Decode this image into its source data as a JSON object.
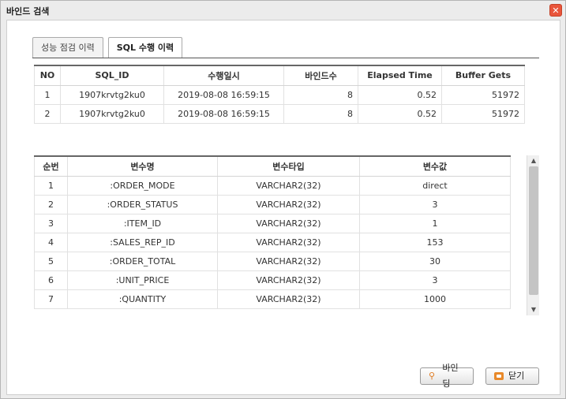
{
  "window": {
    "title": "바인드 검색",
    "close_glyph": "✕"
  },
  "tabs": [
    {
      "label": "성능 점검 이력",
      "active": false
    },
    {
      "label": "SQL 수행 이력",
      "active": true
    }
  ],
  "sql_table": {
    "headers": [
      "NO",
      "SQL_ID",
      "수행일시",
      "바인드수",
      "Elapsed Time",
      "Buffer Gets"
    ],
    "rows": [
      [
        "1",
        "1907krvtg2ku0",
        "2019-08-08 16:59:15",
        "8",
        "0.52",
        "51972"
      ],
      [
        "2",
        "1907krvtg2ku0",
        "2019-08-08 16:59:15",
        "8",
        "0.52",
        "51972"
      ]
    ]
  },
  "bind_table": {
    "headers": [
      "순번",
      "변수명",
      "변수타입",
      "변수값"
    ],
    "rows": [
      [
        "1",
        ":ORDER_MODE",
        "VARCHAR2(32)",
        "direct"
      ],
      [
        "2",
        ":ORDER_STATUS",
        "VARCHAR2(32)",
        "3"
      ],
      [
        "3",
        ":ITEM_ID",
        "VARCHAR2(32)",
        "1"
      ],
      [
        "4",
        ":SALES_REP_ID",
        "VARCHAR2(32)",
        "153"
      ],
      [
        "5",
        ":ORDER_TOTAL",
        "VARCHAR2(32)",
        "30"
      ],
      [
        "6",
        ":UNIT_PRICE",
        "VARCHAR2(32)",
        "3"
      ],
      [
        "7",
        ":QUANTITY",
        "VARCHAR2(32)",
        "1000"
      ]
    ]
  },
  "buttons": {
    "bind_label": "바인딩",
    "close_label": "닫기",
    "bind_icon": "link-icon",
    "close_icon": "close-box-icon"
  },
  "colors": {
    "close_button": "#e9553b",
    "button_icon": "#e8892a"
  }
}
